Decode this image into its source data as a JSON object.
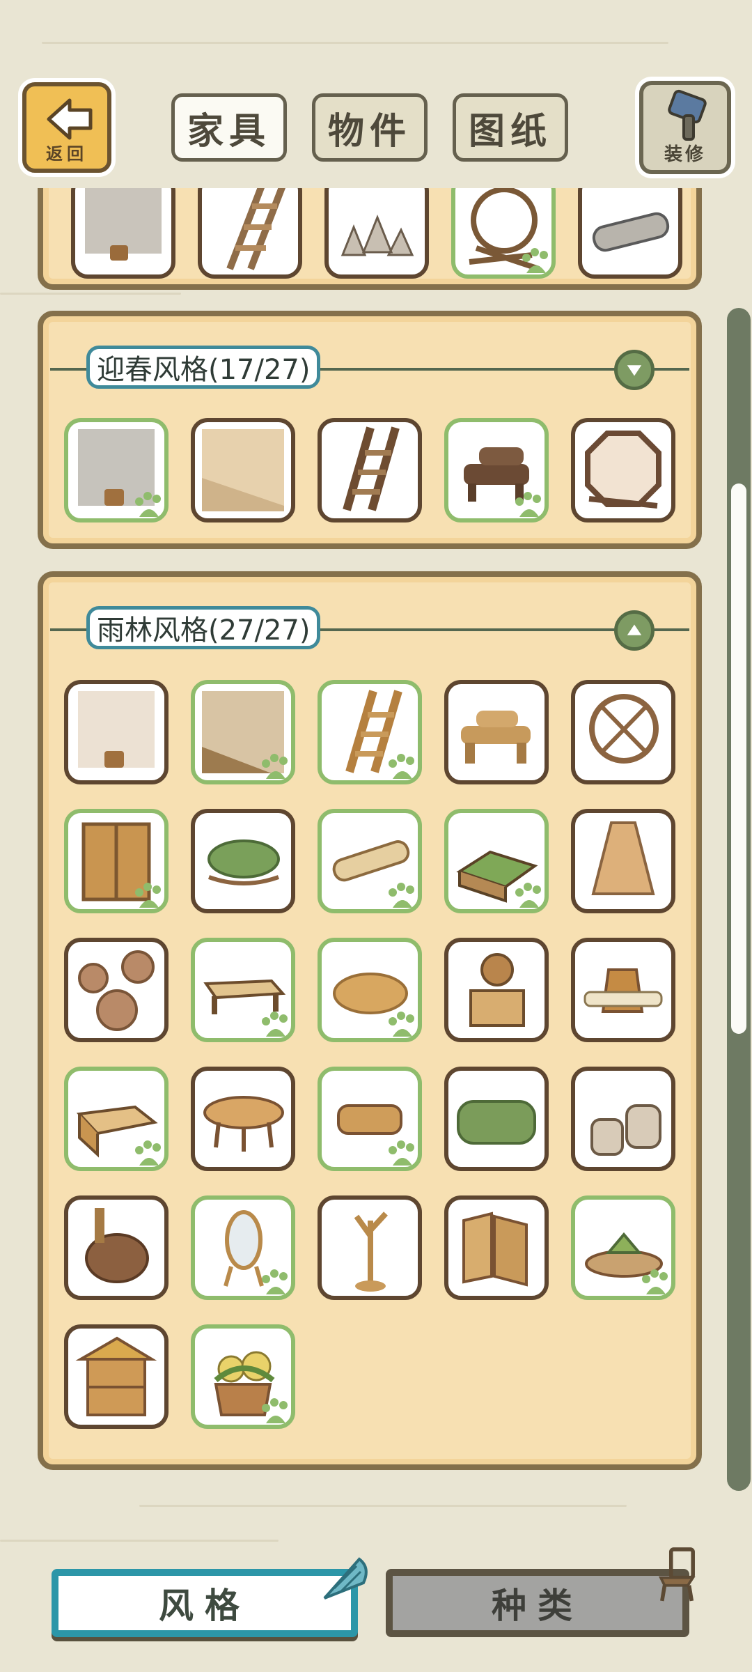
{
  "top_tabs": [
    {
      "label": "家具"
    },
    {
      "label": "物件"
    },
    {
      "label": "图纸"
    }
  ],
  "back": {
    "label": "返回"
  },
  "decorate": {
    "label": "装修"
  },
  "sections": [
    {
      "title": "迎春风格(17/27)",
      "expanded": false
    },
    {
      "title": "雨林风格(27/27)",
      "expanded": true
    }
  ],
  "bottom_tabs": [
    {
      "label": "风格"
    },
    {
      "label": "种类"
    }
  ],
  "colors": {
    "accent": "#2c96a8",
    "owned_border": "#8fbc6c",
    "panel": "#f7e0b2",
    "frame": "#84704b"
  }
}
